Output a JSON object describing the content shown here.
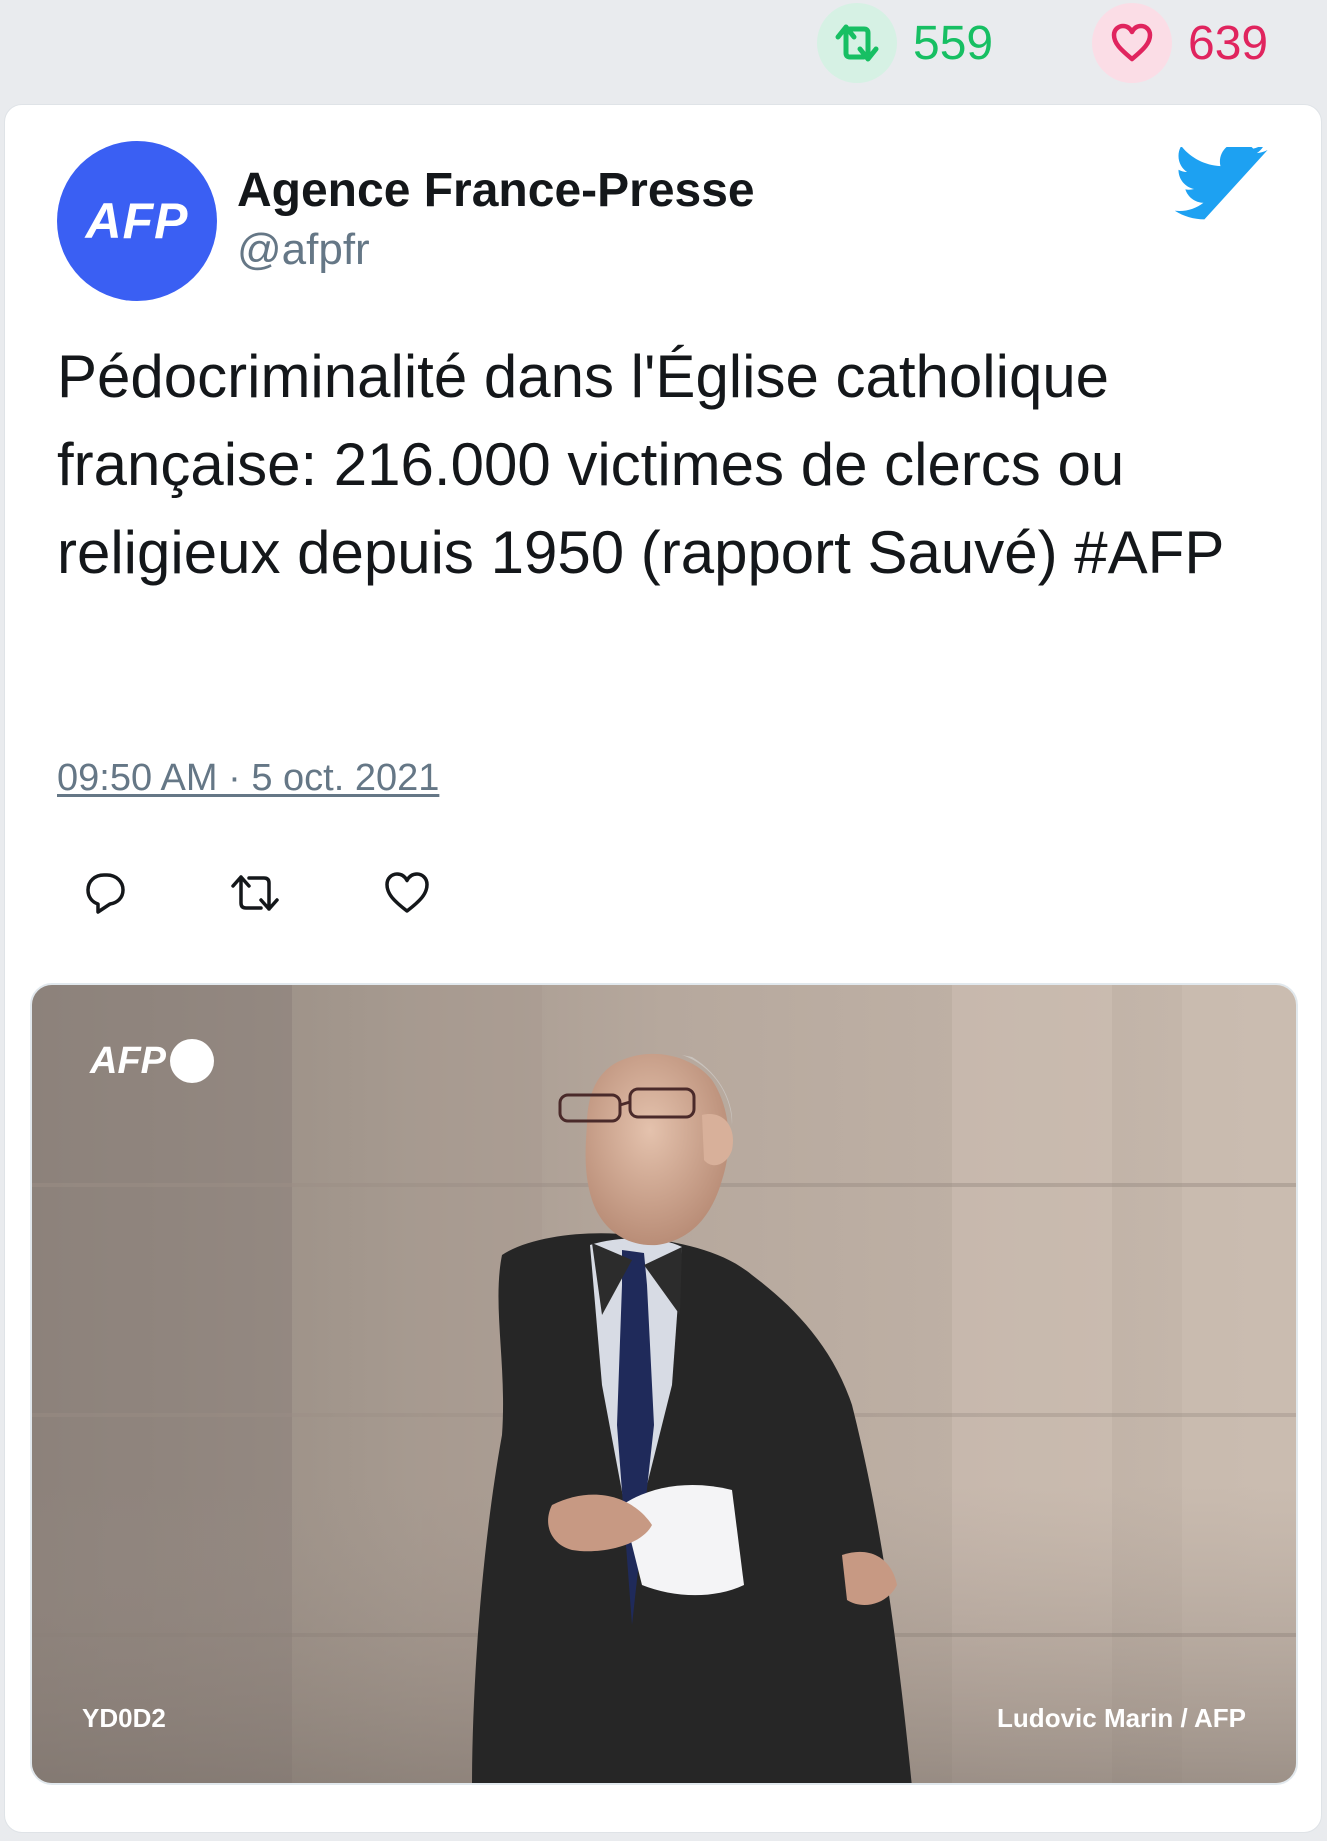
{
  "stats": {
    "retweets": "559",
    "likes": "639",
    "retweet_icon": "retweet-icon",
    "like_icon": "heart-icon",
    "retweet_color": "#17bf63",
    "like_color": "#e0245e"
  },
  "author": {
    "avatar_text": "AFP",
    "name": "Agence France-Presse",
    "handle": "@afpfr",
    "avatar_color": "#3a5ff3"
  },
  "platform_icon": "twitter-bird-icon",
  "tweet": {
    "text": "Pédocriminalité dans l'Église catholique française: 216.000 victimes de clercs ou religieux depuis 1950 (rapport Sauvé) #AFP",
    "timestamp": "09:50 AM · 5 oct. 2021"
  },
  "actions": {
    "reply_icon": "reply-icon",
    "retweet_icon": "retweet-icon",
    "like_icon": "heart-icon"
  },
  "media": {
    "logo_text": "AFP",
    "photo_code": "YD0D2",
    "credit": "Ludovic Marin / AFP"
  }
}
